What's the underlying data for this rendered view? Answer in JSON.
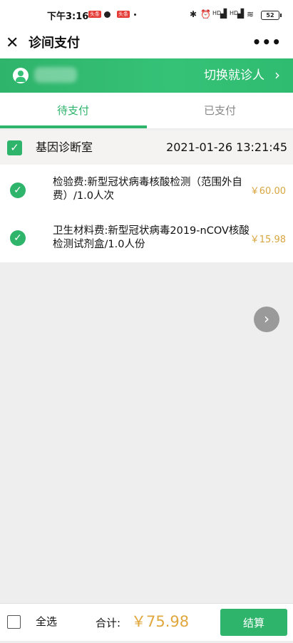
{
  "status_bar": {
    "time": "下午3:16",
    "badges": [
      "头条",
      "头条"
    ],
    "network_labels": [
      "HD",
      "HD"
    ],
    "battery": "52"
  },
  "header": {
    "close_icon": "close-icon",
    "title": "诊间支付",
    "more_icon": "more-dots-icon"
  },
  "patient_bar": {
    "avatar_icon": "user-avatar-icon",
    "switch_label": "切换就诊人",
    "chevron_icon": "chevron-right-icon"
  },
  "tabs": [
    {
      "label": "待支付",
      "active": true
    },
    {
      "label": "已支付",
      "active": false
    }
  ],
  "group": {
    "checked": true,
    "name": "基因诊断室",
    "datetime": "2021-01-26 13:21:45"
  },
  "items": [
    {
      "name": "检验费:新型冠状病毒核酸检测（范围外自费）/1.0人次",
      "price": "￥60.00",
      "checked": true
    },
    {
      "name": "卫生材料费:新型冠状病毒2019-nCOV核酸检测试剂盒/1.0人份",
      "price": "￥15.98",
      "checked": true
    }
  ],
  "footer": {
    "select_all_label": "全选",
    "total_label": "合计:",
    "total_value": "￥75.98",
    "pay_button": "结算"
  },
  "colors": {
    "accent": "#2fb46b",
    "price": "#d9a640"
  }
}
